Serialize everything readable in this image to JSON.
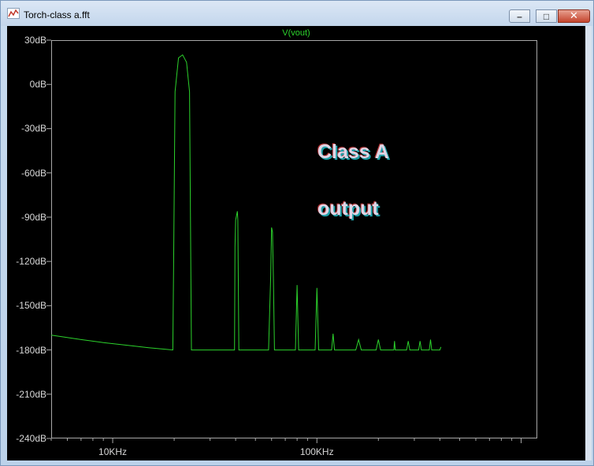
{
  "window": {
    "title": "Torch-class a.fft",
    "minimize_glyph": "–",
    "maximize_glyph": "□",
    "close_glyph": "✕"
  },
  "plot": {
    "trace_label": "V(vout)",
    "annotation_lines": [
      "Class A",
      "output"
    ],
    "colors": {
      "trace": "#2cd22c",
      "background": "#000000",
      "axis": "#a8a8a8",
      "annotation": "#e0d5e6"
    }
  },
  "chart_data": {
    "type": "line",
    "title": "V(vout)",
    "xlabel": "",
    "ylabel": "",
    "xscale": "log",
    "xlim": [
      5000,
      1200000
    ],
    "ylim": [
      -240,
      30
    ],
    "y_ticks": [
      "30dB",
      "0dB",
      "-30dB",
      "-60dB",
      "-90dB",
      "-120dB",
      "-150dB",
      "-180dB",
      "-210dB",
      "-240dB"
    ],
    "y_tick_values": [
      30,
      0,
      -30,
      -60,
      -90,
      -120,
      -150,
      -180,
      -210,
      -240
    ],
    "x_ticks": [
      "10KHz",
      "100KHz"
    ],
    "x_tick_values": [
      10000,
      100000
    ],
    "grid": false,
    "series": [
      {
        "name": "V(vout)",
        "x": [
          5000,
          7000,
          9000,
          12000,
          15000,
          18000,
          19700,
          19900,
          20200,
          21000,
          22000,
          23000,
          23800,
          24100,
          24300,
          26000,
          30000,
          38000,
          39500,
          39700,
          40000,
          40800,
          41000,
          41500,
          47000,
          58000,
          59400,
          60000,
          60600,
          61200,
          62000,
          70000,
          78500,
          80000,
          81400,
          82000,
          90000,
          98000,
          100000,
          102000,
          103000,
          118000,
          120000,
          122000,
          123000,
          155000,
          160000,
          165000,
          195000,
          200000,
          205000,
          238000,
          240000,
          242000,
          275000,
          280000,
          285000,
          315000,
          320000,
          325000,
          355000,
          360000,
          365000,
          400000,
          405000
        ],
        "y": [
          -170,
          -173,
          -175,
          -177,
          -178.5,
          -179.5,
          -180,
          -115,
          -5,
          18,
          20,
          15,
          -5,
          -115,
          -180,
          -180,
          -180,
          -180,
          -180,
          -110,
          -92,
          -86,
          -92,
          -180,
          -180,
          -180,
          -130,
          -97,
          -100,
          -130,
          -180,
          -180,
          -180,
          -136,
          -180,
          -180,
          -180,
          -180,
          -138,
          -180,
          -180,
          -180,
          -169,
          -180,
          -180,
          -180,
          -173,
          -180,
          -180,
          -173,
          -180,
          -180,
          -174,
          -180,
          -180,
          -174,
          -180,
          -180,
          -174,
          -180,
          -180,
          -173,
          -180,
          -180,
          -178
        ]
      }
    ]
  }
}
